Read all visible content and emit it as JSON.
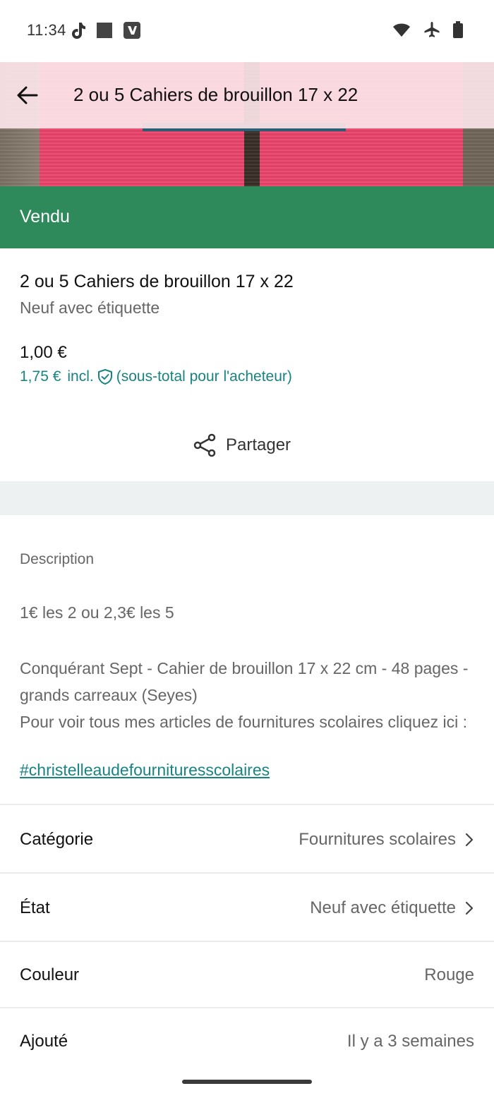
{
  "status_bar": {
    "time": "11:34",
    "icons": [
      "tiktok-icon",
      "square-icon",
      "vinted-icon",
      "wifi-icon",
      "airplane-icon",
      "battery-icon"
    ]
  },
  "header": {
    "title": "2 ou 5 Cahiers de brouillon 17 x 22"
  },
  "banner": {
    "text": "Vendu",
    "color": "#2e8a5b"
  },
  "item": {
    "title": "2 ou 5 Cahiers de brouillon 17 x 22",
    "condition": "Neuf avec étiquette",
    "price": "1,00 €",
    "buyer_total": "1,75 €",
    "buyer_incl": "incl.",
    "buyer_note": "(sous-total pour l'acheteur)"
  },
  "share": {
    "label": "Partager"
  },
  "description": {
    "label": "Description",
    "para1": "1€ les 2 ou 2,3€ les 5",
    "para2": "Conquérant Sept - Cahier de brouillon 17 x 22 cm - 48 pages - grands carreaux (Seyes)\nPour voir tous mes articles de fournitures scolaires cliquez ici :",
    "link": "#christelleaudefournituresscolaires"
  },
  "attributes": [
    {
      "label": "Catégorie",
      "value": "Fournitures scolaires"
    },
    {
      "label": "État",
      "value": "Neuf avec étiquette"
    },
    {
      "label": "Couleur",
      "value": "Rouge"
    },
    {
      "label": "Ajouté",
      "value": "Il y a 3 semaines"
    }
  ],
  "colors": {
    "accent": "#188482",
    "sold": "#2e8a5b",
    "header_bg": "#fce4ea"
  }
}
